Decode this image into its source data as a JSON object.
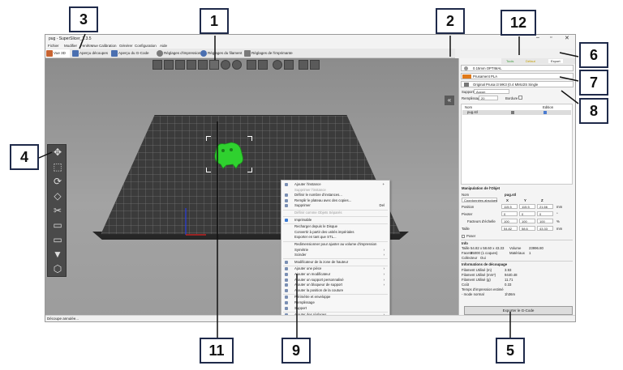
{
  "window": {
    "title": "pug - SuperSlicer_2.3.5",
    "minimize": "–",
    "restore": "▫",
    "close": "✕"
  },
  "menu": [
    "Fichier",
    "Modifier",
    "Fenêtre",
    "Vue",
    "Calibration",
    "Générer",
    "Configuration",
    "Aide"
  ],
  "tabs": [
    {
      "label": "Vue 3D",
      "icon": "cube-icon",
      "color": "#c86432"
    },
    {
      "label": "Aperçu découpes",
      "icon": "layers-icon",
      "color": "#4a6fb0"
    },
    {
      "label": "Aperçu du G-Code",
      "icon": "gcode-icon",
      "color": "#4a6fb0"
    },
    {
      "label": "Réglages d'impression",
      "icon": "gear-icon",
      "color": "#7a7a7a"
    },
    {
      "label": "Réglages du filament",
      "icon": "spool-icon",
      "color": "#4a6fb0"
    },
    {
      "label": "Réglages de l'imprimante",
      "icon": "printer-icon",
      "color": "#7a7a7a"
    }
  ],
  "export_tabs": [
    "Tools",
    "Défaut",
    "Export"
  ],
  "presets": {
    "print": "0.15mm OPTIMAL",
    "filament": "Prusament PLA",
    "printer": "Original Prusa i3 MK3 (0.4 MMU2S Single"
  },
  "supports": {
    "label": "Supports",
    "value": "Aucun"
  },
  "infill": {
    "label": "Remplissage",
    "value": "20",
    "brim_label": "Bordure"
  },
  "object_list": {
    "col_name": "Nom",
    "col_edit": "Edition",
    "item": "pug.stl"
  },
  "manipulation": {
    "title": "Manipulation de l'Objet",
    "name_label": "Nom",
    "name_value": "pug.stl",
    "coords": "Coordonnées absolues",
    "axes": [
      "X",
      "Y",
      "Z"
    ],
    "rows": [
      {
        "label": "Position",
        "values": [
          "115.5",
          "115.5",
          "21.66"
        ],
        "unit": "mm"
      },
      {
        "label": "Pivoter",
        "values": [
          "0",
          "0",
          "0"
        ],
        "unit": "°"
      },
      {
        "label": "Facteurs d'échelle",
        "values": [
          "100",
          "100",
          "100"
        ],
        "unit": "%"
      },
      {
        "label": "Taille",
        "values": [
          "54.82",
          "58.6",
          "43.33"
        ],
        "unit": "mm"
      }
    ],
    "drop_label": "Poser"
  },
  "info": {
    "title": "Info",
    "size_label": "Taille",
    "size_value": "54.82 x 58.60 x 43.33",
    "volume_label": "Volume",
    "volume_value": "23996.80",
    "facets_label": "Facets",
    "facets_value": "35000 (1 coques)",
    "materials_label": "Matériaux",
    "materials_value": "1",
    "collector_label": "Collecteur",
    "collector_value": "Oui"
  },
  "slice_info": {
    "title": "Informations de découpage",
    "rows": [
      {
        "label": "Filament Utilisé (m)",
        "value": "3.93"
      },
      {
        "label": "Filament Utilisé (mm³)",
        "value": "9440.48"
      },
      {
        "label": "Filament Utilisé (g)",
        "value": "11.71"
      },
      {
        "label": "Coût",
        "value": "0.33"
      },
      {
        "label": "Temps d'impression estimé",
        "value": ""
      },
      {
        "label": "- mode normal",
        "value": "1h36m"
      }
    ]
  },
  "export_button": "Exporter le G-Code",
  "status": "Découpe annulée...",
  "context_menu": [
    {
      "label": "Ajouter l'instance",
      "shortcut": "+",
      "icon": "plus-icon",
      "disabled": false
    },
    {
      "label": "Supprimer l'instance",
      "shortcut": "",
      "icon": "",
      "disabled": true
    },
    {
      "label": "Définir le nombre d'instances...",
      "shortcut": "",
      "icon": "instances-icon",
      "disabled": false
    },
    {
      "label": "Remplir le plateau avec des copies...",
      "shortcut": "",
      "icon": "fill-icon",
      "disabled": false
    },
    {
      "label": "Supprimer",
      "shortcut": "Del",
      "icon": "trash-icon",
      "disabled": false
    },
    {
      "label": "Définir comme Objets Séparés",
      "shortcut": "",
      "icon": "",
      "disabled": true
    },
    {
      "label": "Imprimable",
      "shortcut": "",
      "icon": "check-icon",
      "disabled": false
    },
    {
      "label": "Recharger depuis le Disque",
      "shortcut": "",
      "icon": "",
      "disabled": false
    },
    {
      "label": "Convertir à partir des unités impériales",
      "shortcut": "",
      "icon": "",
      "disabled": false
    },
    {
      "label": "Exporter en tant que STL...",
      "shortcut": "",
      "icon": "",
      "disabled": false
    },
    {
      "label": "Redimensionner pour ajuster au volume d'impression",
      "shortcut": "",
      "icon": "",
      "disabled": false
    },
    {
      "label": "Symétrie",
      "shortcut": "›",
      "icon": "",
      "disabled": false
    },
    {
      "label": "Scinder",
      "shortcut": "›",
      "icon": "",
      "disabled": false
    },
    {
      "label": "Modificateur de la zone de hauteur",
      "shortcut": "",
      "icon": "height-icon",
      "disabled": false
    },
    {
      "label": "Ajouter une pièce",
      "shortcut": "›",
      "icon": "part-icon",
      "disabled": false
    },
    {
      "label": "Ajouter un modificateur",
      "shortcut": "›",
      "icon": "modifier-icon",
      "disabled": false
    },
    {
      "label": "Ajouter un support personnalisé",
      "shortcut": "›",
      "icon": "support-icon",
      "disabled": false
    },
    {
      "label": "Ajouter un bloqueur de support",
      "shortcut": "›",
      "icon": "blocker-icon",
      "disabled": false
    },
    {
      "label": "Ajouter la position de la couture",
      "shortcut": "",
      "icon": "seam-icon",
      "disabled": false
    },
    {
      "label": "Périmètre et enveloppe",
      "shortcut": "",
      "icon": "perimeter-icon",
      "disabled": false
    },
    {
      "label": "Remplissage",
      "shortcut": "",
      "icon": "infill-icon",
      "disabled": false
    },
    {
      "label": "Support",
      "shortcut": "",
      "icon": "support-icon",
      "disabled": false
    },
    {
      "label": "Ajouter des réglages",
      "shortcut": "›",
      "icon": "settings-icon",
      "disabled": false
    }
  ],
  "callouts": {
    "c1": "1",
    "c2": "2",
    "c3": "3",
    "c4": "4",
    "c5": "5",
    "c6": "6",
    "c7": "7",
    "c8": "8",
    "c9": "9",
    "c11": "11",
    "c12": "12"
  },
  "colors": {
    "accent": "#c86432",
    "model": "#2fd12f",
    "plate": "#3b3b3b",
    "callout_border": "#1f2a4a"
  }
}
